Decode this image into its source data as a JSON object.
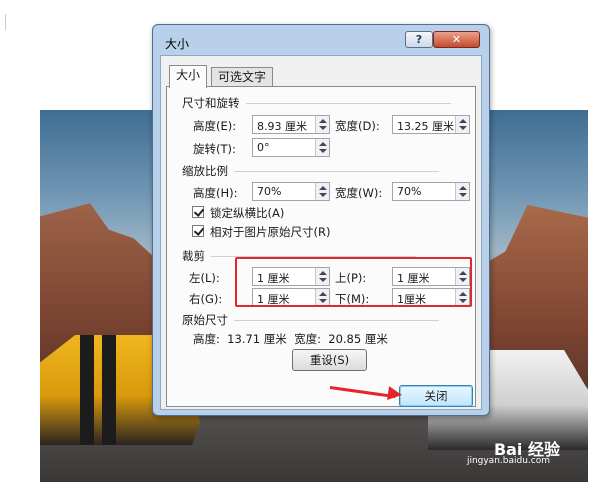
{
  "dialog": {
    "title": "大小",
    "help_label": "?",
    "close_label": "✕",
    "tabs": [
      {
        "label": "大小",
        "active": true
      },
      {
        "label": "可选文字",
        "active": false
      }
    ],
    "size_rotate": {
      "title": "尺寸和旋转",
      "height_label": "高度(E):",
      "height_value": "8.93 厘米",
      "width_label": "宽度(D):",
      "width_value": "13.25 厘米",
      "rotate_label": "旋转(T):",
      "rotate_value": "0°"
    },
    "scale": {
      "title": "缩放比例",
      "height_label": "高度(H):",
      "height_value": "70%",
      "width_label": "宽度(W):",
      "width_value": "70%",
      "lock_aspect_label": "锁定纵横比(A)",
      "lock_aspect_checked": true,
      "relative_label": "相对于图片原始尺寸(R)",
      "relative_checked": true
    },
    "crop": {
      "title": "裁剪",
      "left_label": "左(L):",
      "left_value": "1 厘米",
      "top_label": "上(P):",
      "top_value": "1 厘米",
      "right_label": "右(G):",
      "right_value": "1 厘米",
      "bottom_label": "下(M):",
      "bottom_value": "1厘米"
    },
    "original": {
      "title": "原始尺寸",
      "text": "高度:  13.71 厘米  宽度:  20.85 厘米"
    },
    "reset_label": "重设(S)",
    "close_button_label": "关闭"
  },
  "watermark": {
    "text": "Bai 经验",
    "sub": "jingyan.baidu.com"
  },
  "colors": {
    "annotation_red": "#e0282d",
    "dialog_frame": "#b8d0ea"
  }
}
